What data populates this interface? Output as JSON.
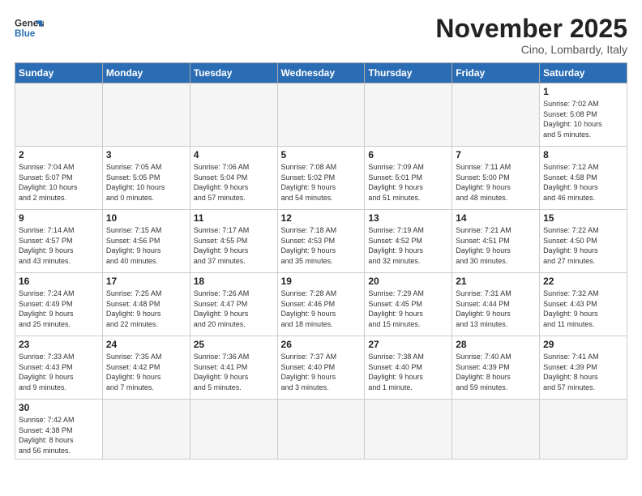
{
  "header": {
    "logo_general": "General",
    "logo_blue": "Blue",
    "month_title": "November 2025",
    "location": "Cino, Lombardy, Italy"
  },
  "weekdays": [
    "Sunday",
    "Monday",
    "Tuesday",
    "Wednesday",
    "Thursday",
    "Friday",
    "Saturday"
  ],
  "days": [
    {
      "num": "",
      "info": ""
    },
    {
      "num": "",
      "info": ""
    },
    {
      "num": "",
      "info": ""
    },
    {
      "num": "",
      "info": ""
    },
    {
      "num": "",
      "info": ""
    },
    {
      "num": "",
      "info": ""
    },
    {
      "num": "1",
      "info": "Sunrise: 7:02 AM\nSunset: 5:08 PM\nDaylight: 10 hours\nand 5 minutes."
    },
    {
      "num": "2",
      "info": "Sunrise: 7:04 AM\nSunset: 5:07 PM\nDaylight: 10 hours\nand 2 minutes."
    },
    {
      "num": "3",
      "info": "Sunrise: 7:05 AM\nSunset: 5:05 PM\nDaylight: 10 hours\nand 0 minutes."
    },
    {
      "num": "4",
      "info": "Sunrise: 7:06 AM\nSunset: 5:04 PM\nDaylight: 9 hours\nand 57 minutes."
    },
    {
      "num": "5",
      "info": "Sunrise: 7:08 AM\nSunset: 5:02 PM\nDaylight: 9 hours\nand 54 minutes."
    },
    {
      "num": "6",
      "info": "Sunrise: 7:09 AM\nSunset: 5:01 PM\nDaylight: 9 hours\nand 51 minutes."
    },
    {
      "num": "7",
      "info": "Sunrise: 7:11 AM\nSunset: 5:00 PM\nDaylight: 9 hours\nand 48 minutes."
    },
    {
      "num": "8",
      "info": "Sunrise: 7:12 AM\nSunset: 4:58 PM\nDaylight: 9 hours\nand 46 minutes."
    },
    {
      "num": "9",
      "info": "Sunrise: 7:14 AM\nSunset: 4:57 PM\nDaylight: 9 hours\nand 43 minutes."
    },
    {
      "num": "10",
      "info": "Sunrise: 7:15 AM\nSunset: 4:56 PM\nDaylight: 9 hours\nand 40 minutes."
    },
    {
      "num": "11",
      "info": "Sunrise: 7:17 AM\nSunset: 4:55 PM\nDaylight: 9 hours\nand 37 minutes."
    },
    {
      "num": "12",
      "info": "Sunrise: 7:18 AM\nSunset: 4:53 PM\nDaylight: 9 hours\nand 35 minutes."
    },
    {
      "num": "13",
      "info": "Sunrise: 7:19 AM\nSunset: 4:52 PM\nDaylight: 9 hours\nand 32 minutes."
    },
    {
      "num": "14",
      "info": "Sunrise: 7:21 AM\nSunset: 4:51 PM\nDaylight: 9 hours\nand 30 minutes."
    },
    {
      "num": "15",
      "info": "Sunrise: 7:22 AM\nSunset: 4:50 PM\nDaylight: 9 hours\nand 27 minutes."
    },
    {
      "num": "16",
      "info": "Sunrise: 7:24 AM\nSunset: 4:49 PM\nDaylight: 9 hours\nand 25 minutes."
    },
    {
      "num": "17",
      "info": "Sunrise: 7:25 AM\nSunset: 4:48 PM\nDaylight: 9 hours\nand 22 minutes."
    },
    {
      "num": "18",
      "info": "Sunrise: 7:26 AM\nSunset: 4:47 PM\nDaylight: 9 hours\nand 20 minutes."
    },
    {
      "num": "19",
      "info": "Sunrise: 7:28 AM\nSunset: 4:46 PM\nDaylight: 9 hours\nand 18 minutes."
    },
    {
      "num": "20",
      "info": "Sunrise: 7:29 AM\nSunset: 4:45 PM\nDaylight: 9 hours\nand 15 minutes."
    },
    {
      "num": "21",
      "info": "Sunrise: 7:31 AM\nSunset: 4:44 PM\nDaylight: 9 hours\nand 13 minutes."
    },
    {
      "num": "22",
      "info": "Sunrise: 7:32 AM\nSunset: 4:43 PM\nDaylight: 9 hours\nand 11 minutes."
    },
    {
      "num": "23",
      "info": "Sunrise: 7:33 AM\nSunset: 4:43 PM\nDaylight: 9 hours\nand 9 minutes."
    },
    {
      "num": "24",
      "info": "Sunrise: 7:35 AM\nSunset: 4:42 PM\nDaylight: 9 hours\nand 7 minutes."
    },
    {
      "num": "25",
      "info": "Sunrise: 7:36 AM\nSunset: 4:41 PM\nDaylight: 9 hours\nand 5 minutes."
    },
    {
      "num": "26",
      "info": "Sunrise: 7:37 AM\nSunset: 4:40 PM\nDaylight: 9 hours\nand 3 minutes."
    },
    {
      "num": "27",
      "info": "Sunrise: 7:38 AM\nSunset: 4:40 PM\nDaylight: 9 hours\nand 1 minute."
    },
    {
      "num": "28",
      "info": "Sunrise: 7:40 AM\nSunset: 4:39 PM\nDaylight: 8 hours\nand 59 minutes."
    },
    {
      "num": "29",
      "info": "Sunrise: 7:41 AM\nSunset: 4:39 PM\nDaylight: 8 hours\nand 57 minutes."
    },
    {
      "num": "30",
      "info": "Sunrise: 7:42 AM\nSunset: 4:38 PM\nDaylight: 8 hours\nand 56 minutes."
    }
  ]
}
